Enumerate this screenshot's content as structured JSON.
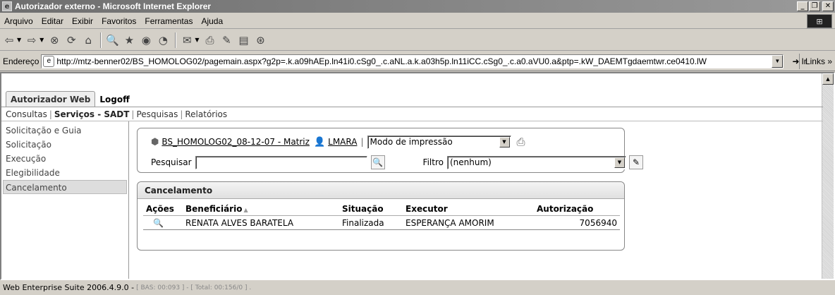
{
  "window": {
    "title": "Autorizador externo - Microsoft Internet Explorer",
    "minimize": "_",
    "maximize": "❐",
    "close": "✕"
  },
  "menubar": {
    "items": [
      "Arquivo",
      "Editar",
      "Exibir",
      "Favoritos",
      "Ferramentas",
      "Ajuda"
    ]
  },
  "addressbar": {
    "label": "Endereço",
    "url": "http://mtz-benner02/BS_HOMOLOG02/pagemain.aspx?g2p=.k.a09hAEp.ln41i0.cSg0_.c.aNL.a.k.a03h5p.ln11iCC.cSg0_.c.a0.aVU0.a&ptp=.kW_DAEMTgdaemtwr.ce0410.lW",
    "go_label": "Ir",
    "links_label": "Links »"
  },
  "app": {
    "tabs": [
      "Autorizador Web",
      "Logoff"
    ],
    "subnav": {
      "items": [
        "Consultas",
        "Serviços - SADT",
        "Pesquisas",
        "Relatórios"
      ]
    },
    "leftnav": [
      "Solicitação e Guia",
      "Solicitação",
      "Execução",
      "Elegibilidade",
      "Cancelamento"
    ],
    "filters": {
      "environment_link": "BS_HOMOLOG02_08-12-07 - Matriz",
      "user_link": "LMARA",
      "mode_select": "Modo de impressão",
      "search_label": "Pesquisar",
      "search_value": "",
      "filter_label": "Filtro",
      "filter_select": "(nenhum)"
    },
    "results": {
      "title": "Cancelamento",
      "columns": [
        "Ações",
        "Beneficiário",
        "Situação",
        "Executor",
        "Autorização"
      ],
      "rows": [
        {
          "beneficiario": "RENATA ALVES BARATELA",
          "situacao": "Finalizada",
          "executor": "ESPERANÇA AMORIM",
          "autorizacao": "7056940"
        }
      ]
    }
  },
  "statusbar": {
    "text": "Web Enterprise Suite 2006.4.9.0 -",
    "timing": "[ BAS: 00:093 ] - [ Total: 00:156/0 ] ."
  }
}
